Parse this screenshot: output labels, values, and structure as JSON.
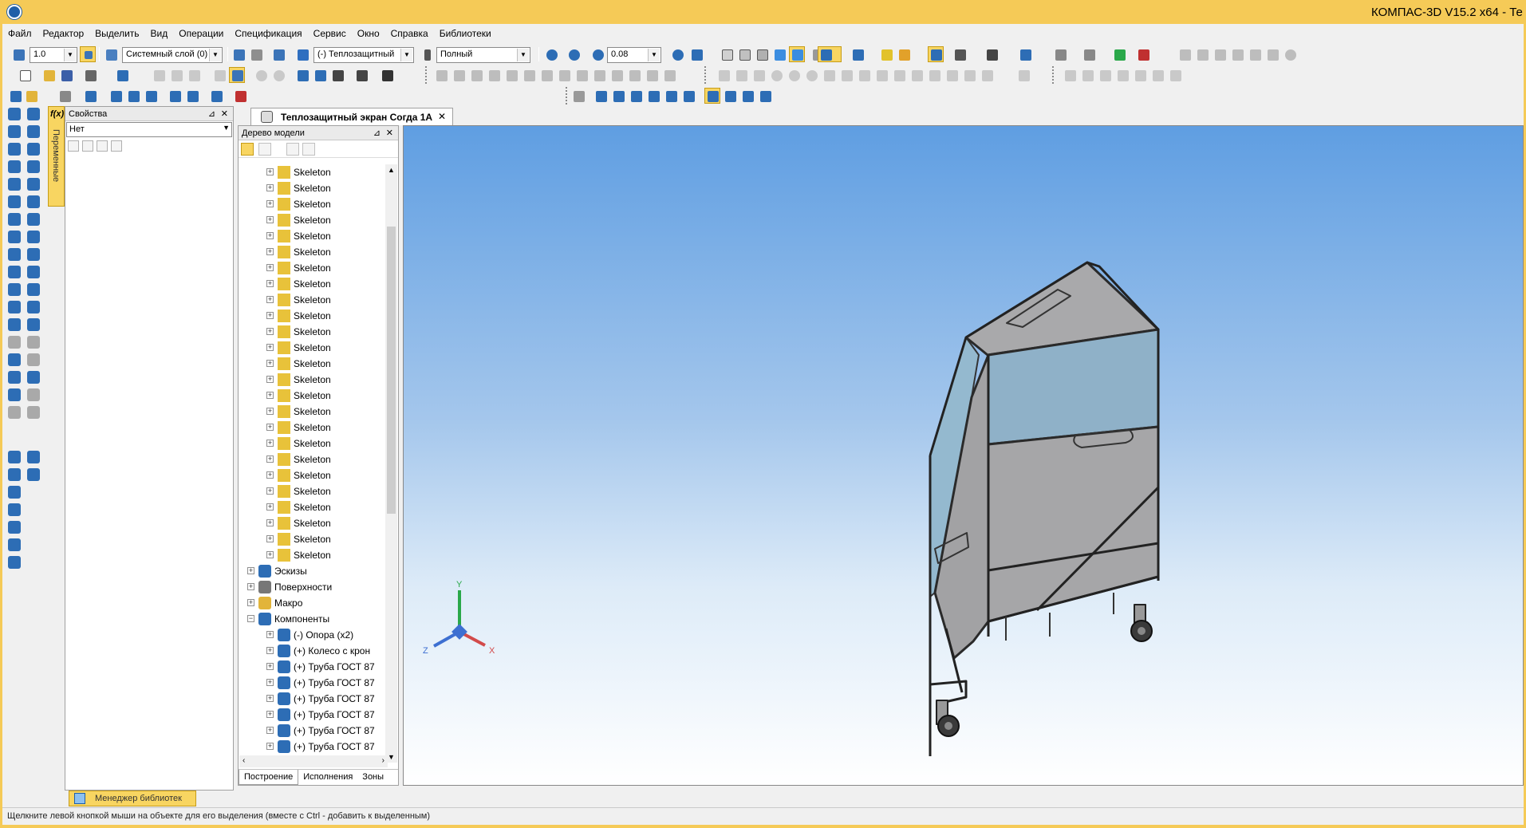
{
  "title": "КОМПАС-3D V15.2  x64 - Те",
  "menu": [
    "Файл",
    "Редактор",
    "Выделить",
    "Вид",
    "Операции",
    "Спецификация",
    "Сервис",
    "Окно",
    "Справка",
    "Библиотеки"
  ],
  "toolbar": {
    "step": "1.0",
    "layer": "Системный слой (0)",
    "object": "(-) Теплозащитный",
    "display_mode": "Полный",
    "zoom": "0.08"
  },
  "properties": {
    "title": "Свойства",
    "fx_label": "f(x)",
    "variables_tab": "Переменные",
    "combo_value": "Нет"
  },
  "document_tab": "Теплозащитный экран Согда 1А",
  "tree": {
    "title": "Дерево модели",
    "items": [
      {
        "label": "Skeleton",
        "icon": "skeleton-icon"
      },
      {
        "label": "Skeleton",
        "icon": "skeleton-icon"
      },
      {
        "label": "Skeleton",
        "icon": "skeleton-icon"
      },
      {
        "label": "Skeleton",
        "icon": "skeleton-icon"
      },
      {
        "label": "Skeleton",
        "icon": "skeleton-icon"
      },
      {
        "label": "Skeleton",
        "icon": "skeleton-icon"
      },
      {
        "label": "Skeleton",
        "icon": "skeleton-icon"
      },
      {
        "label": "Skeleton",
        "icon": "skeleton-icon"
      },
      {
        "label": "Skeleton",
        "icon": "skeleton-icon"
      },
      {
        "label": "Skeleton",
        "icon": "skeleton-icon"
      },
      {
        "label": "Skeleton",
        "icon": "skeleton-icon"
      },
      {
        "label": "Skeleton",
        "icon": "skeleton-icon"
      },
      {
        "label": "Skeleton",
        "icon": "skeleton-icon"
      },
      {
        "label": "Skeleton",
        "icon": "skeleton-icon"
      },
      {
        "label": "Skeleton",
        "icon": "skeleton-icon"
      },
      {
        "label": "Skeleton",
        "icon": "skeleton-icon"
      },
      {
        "label": "Skeleton",
        "icon": "skeleton-icon"
      },
      {
        "label": "Skeleton",
        "icon": "skeleton-icon"
      },
      {
        "label": "Skeleton",
        "icon": "skeleton-icon"
      },
      {
        "label": "Skeleton",
        "icon": "skeleton-icon"
      },
      {
        "label": "Skeleton",
        "icon": "skeleton-icon"
      },
      {
        "label": "Skeleton",
        "icon": "skeleton-icon"
      },
      {
        "label": "Skeleton",
        "icon": "skeleton-icon"
      },
      {
        "label": "Skeleton",
        "icon": "skeleton-icon"
      },
      {
        "label": "Skeleton",
        "icon": "skeleton-icon"
      },
      {
        "label": "Эскизы",
        "icon": "sketch-folder-icon"
      },
      {
        "label": "Поверхности",
        "icon": "surfaces-icon"
      },
      {
        "label": "Макро",
        "icon": "macro-icon"
      },
      {
        "label": "Компоненты",
        "icon": "components-icon"
      },
      {
        "label": "(-) Опора (x2)",
        "icon": "component-icon"
      },
      {
        "label": "(+) Колесо с крон",
        "icon": "component-icon"
      },
      {
        "label": "(+) Труба ГОСТ 87",
        "icon": "component-icon"
      },
      {
        "label": "(+) Труба ГОСТ 87",
        "icon": "component-icon"
      },
      {
        "label": "(+) Труба ГОСТ 87",
        "icon": "component-icon"
      },
      {
        "label": "(+) Труба ГОСТ 87",
        "icon": "component-icon"
      },
      {
        "label": "(+) Труба ГОСТ 87",
        "icon": "component-icon"
      },
      {
        "label": "(+) Труба ГОСТ 87",
        "icon": "component-icon"
      }
    ],
    "tabs": [
      "Построение",
      "Исполнения",
      "Зоны"
    ]
  },
  "axes": {
    "x": "X",
    "y": "Y",
    "z": "Z"
  },
  "library_manager": "Менеджер библиотек",
  "status": "Щелкните левой кнопкой мыши на объекте для его выделения (вместе с Ctrl - добавить к выделенным)",
  "colors": {
    "frame": "#f5ca57",
    "active": "#f8d561",
    "viewport_top": "#5f9ee2",
    "viewport_bottom": "#ffffff",
    "model_panel": "#a6a6a8",
    "model_glass": "#8fb1c8"
  }
}
